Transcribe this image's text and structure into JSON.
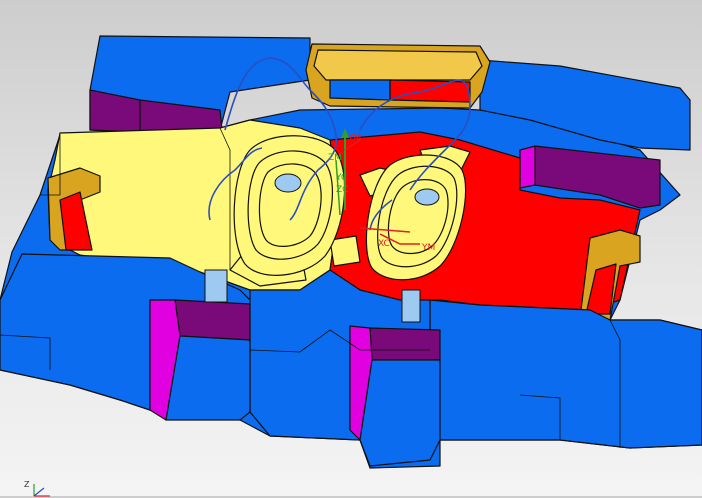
{
  "viewport": {
    "background_top": "#cdcdcd",
    "background_bottom": "#f4f4f4"
  },
  "colors": {
    "plate_blue": "#0b6cf0",
    "cavity_red": "#ff0000",
    "insert_yellow": "#fff87a",
    "slot_purple": "#7a0a7a",
    "slot_magenta": "#e000e0",
    "slider_gold": "#d9a520",
    "edge": "#111111",
    "wire_navy": "#2a4fc0",
    "axis_green": "#2e9e2e",
    "axis_red": "#e02020"
  },
  "wcs_labels": {
    "zm": "ZM",
    "ym_top": "YM",
    "yc": "YC",
    "zc": "ZC",
    "xc": "XC",
    "ym_right": "YM"
  },
  "view_triad": {
    "z_label": "Z",
    "icon": "view-triad-icon"
  }
}
